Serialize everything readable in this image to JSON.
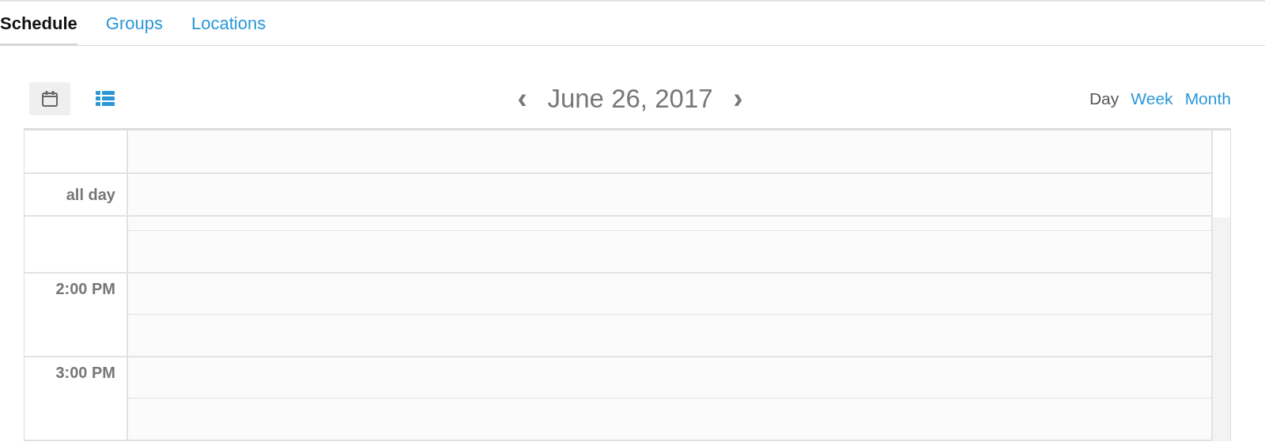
{
  "tabs": [
    {
      "label": "Schedule",
      "selected": true
    },
    {
      "label": "Groups",
      "selected": false
    },
    {
      "label": "Locations",
      "selected": false
    }
  ],
  "toolbar": {
    "view_modes": [
      {
        "kind": "calendar",
        "selected": true
      },
      {
        "kind": "list",
        "selected": false
      }
    ],
    "prev": "‹",
    "title": "June 26, 2017",
    "next": "›",
    "ranges": [
      {
        "label": "Day",
        "selected": true
      },
      {
        "label": "Week",
        "selected": false
      },
      {
        "label": "Month",
        "selected": false
      }
    ]
  },
  "calendar": {
    "all_day_label": "all day",
    "hours": [
      "2:00 PM",
      "3:00 PM"
    ]
  }
}
